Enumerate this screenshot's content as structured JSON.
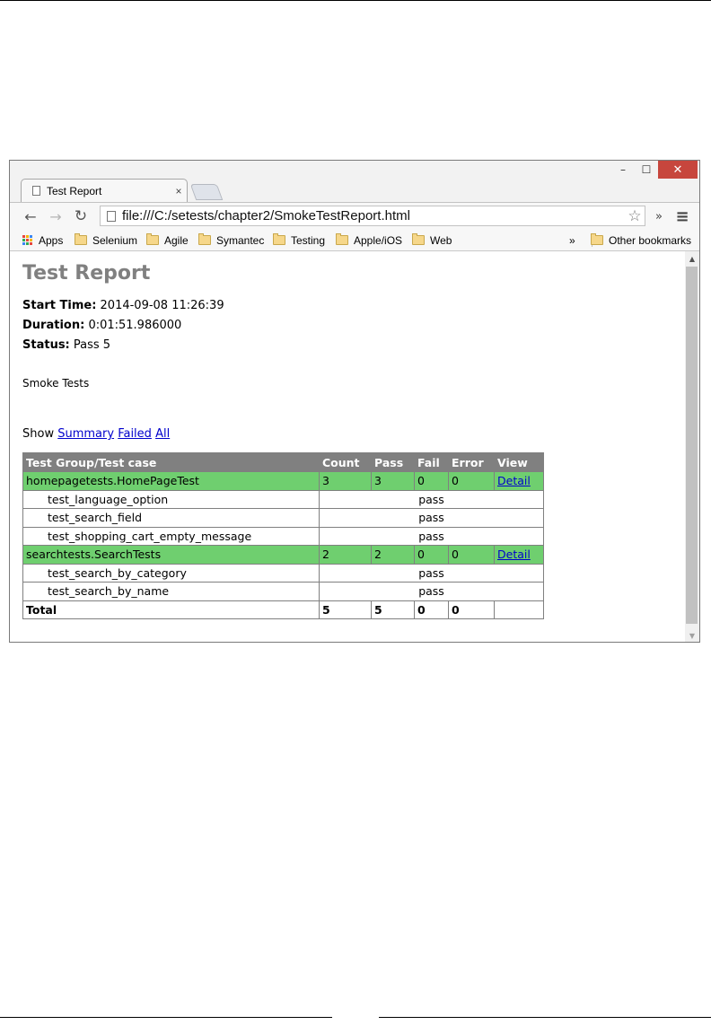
{
  "browser": {
    "window_controls": {
      "minimize": "–",
      "maximize": "☐",
      "close": "✕"
    },
    "tab": {
      "title": "Test Report",
      "close": "×"
    },
    "toolbar": {
      "back": "←",
      "forward": "→",
      "reload": "↻",
      "url": "file:///C:/setests/chapter2/SmokeTestReport.html",
      "star": "☆",
      "extensions": "»",
      "menu": "≡"
    },
    "bookmarks": {
      "apps": "Apps",
      "items": [
        "Selenium",
        "Agile",
        "Symantec",
        "Testing",
        "Apple/iOS",
        "Web"
      ],
      "overflow": "»",
      "other": "Other bookmarks"
    }
  },
  "report": {
    "title": "Test Report",
    "start_time_label": "Start Time:",
    "start_time": "2014-09-08 11:26:39",
    "duration_label": "Duration:",
    "duration": "0:01:51.986000",
    "status_label": "Status:",
    "status": "Pass 5",
    "description": "Smoke Tests",
    "show_label": "Show",
    "filters": [
      "Summary",
      "Failed",
      "All"
    ],
    "table": {
      "headers": [
        "Test Group/Test case",
        "Count",
        "Pass",
        "Fail",
        "Error",
        "View"
      ],
      "group1": {
        "name": "homepagetests.HomePageTest",
        "count": "3",
        "pass": "3",
        "fail": "0",
        "error": "0",
        "view": "Detail"
      },
      "group1_cases": [
        {
          "name": "test_language_option",
          "result": "pass"
        },
        {
          "name": "test_search_field",
          "result": "pass"
        },
        {
          "name": "test_shopping_cart_empty_message",
          "result": "pass"
        }
      ],
      "group2": {
        "name": "searchtests.SearchTests",
        "count": "2",
        "pass": "2",
        "fail": "0",
        "error": "0",
        "view": "Detail"
      },
      "group2_cases": [
        {
          "name": "test_search_by_category",
          "result": "pass"
        },
        {
          "name": "test_search_by_name",
          "result": "pass"
        }
      ],
      "total": {
        "label": "Total",
        "count": "5",
        "pass": "5",
        "fail": "0",
        "error": "0"
      }
    }
  },
  "colors": {
    "group_row": "#6fcf6f",
    "header_row": "#808080",
    "close_button": "#c7463d",
    "link": "#0000cc"
  }
}
